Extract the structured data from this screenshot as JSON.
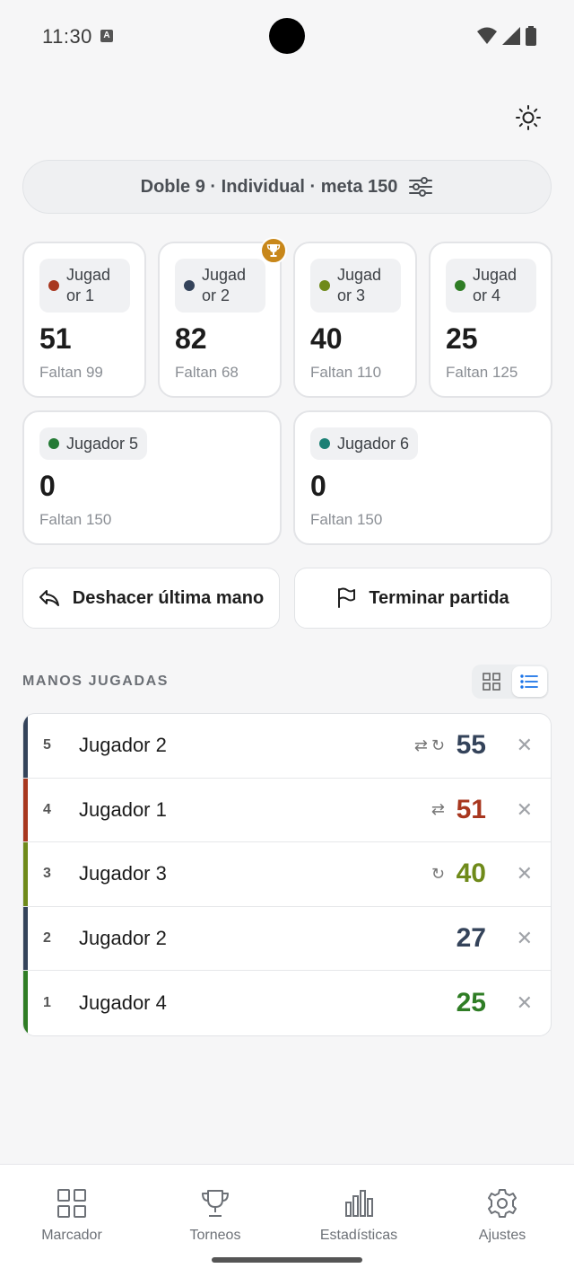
{
  "status": {
    "time": "11:30",
    "a_badge": "A"
  },
  "config": {
    "label": "Doble 9 · Individual · meta 150"
  },
  "players_top": [
    {
      "name": "Jugador 1",
      "score": "51",
      "remaining": "Faltan 99",
      "color": "#a8371f"
    },
    {
      "name": "Jugador 2",
      "score": "82",
      "remaining": "Faltan 68",
      "color": "#34435a"
    },
    {
      "name": "Jugador 3",
      "score": "40",
      "remaining": "Faltan 110",
      "color": "#6f8a1a"
    },
    {
      "name": "Jugador 4",
      "score": "25",
      "remaining": "Faltan 125",
      "color": "#2f7d25"
    }
  ],
  "players_bottom": [
    {
      "name": "Jugador 5",
      "score": "0",
      "remaining": "Faltan 150",
      "color": "#247a35"
    },
    {
      "name": "Jugador 6",
      "score": "0",
      "remaining": "Faltan 150",
      "color": "#1a7f74"
    }
  ],
  "actions": {
    "undo": "Deshacer última mano",
    "finish": "Terminar partida"
  },
  "section": {
    "title": "MANOS JUGADAS"
  },
  "hands": [
    {
      "num": "5",
      "player": "Jugador 2",
      "points": "55",
      "color": "#34435a",
      "swap": true,
      "repeat": true
    },
    {
      "num": "4",
      "player": "Jugador 1",
      "points": "51",
      "color": "#a8371f",
      "swap": true,
      "repeat": false
    },
    {
      "num": "3",
      "player": "Jugador 3",
      "points": "40",
      "color": "#6f8a1a",
      "swap": false,
      "repeat": true
    },
    {
      "num": "2",
      "player": "Jugador 2",
      "points": "27",
      "color": "#34435a",
      "swap": false,
      "repeat": false
    },
    {
      "num": "1",
      "player": "Jugador 4",
      "points": "25",
      "color": "#2f7d25",
      "swap": false,
      "repeat": false
    }
  ],
  "nav": [
    {
      "label": "Marcador",
      "icon": "grid-icon"
    },
    {
      "label": "Torneos",
      "icon": "trophy-icon"
    },
    {
      "label": "Estadísticas",
      "icon": "bar-chart-icon"
    },
    {
      "label": "Ajustes",
      "icon": "gear-icon"
    }
  ],
  "colors": {
    "accent": "#1a73e8",
    "trophy": "#c8871a"
  }
}
